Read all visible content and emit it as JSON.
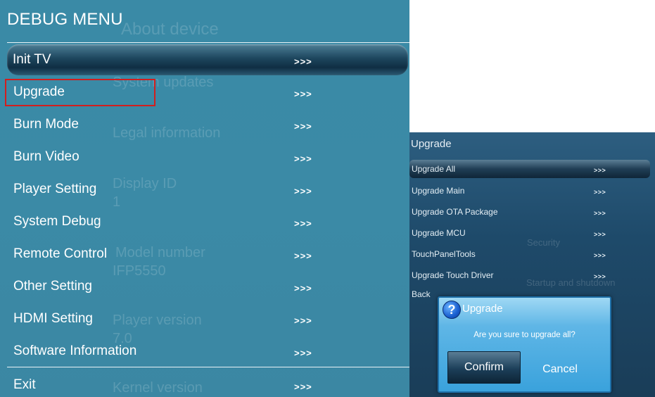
{
  "debug_menu": {
    "title": "DEBUG MENU",
    "background_texts": {
      "about": "About device",
      "updates": "System updates",
      "legal": "Legal information",
      "display_id": "Display ID",
      "display_id_value": "1",
      "model": "Model number",
      "model_value": "IFP5550",
      "player": "Player version",
      "player_value": "7.0",
      "kernel": "Kernel version"
    },
    "items": [
      {
        "label": "Init TV",
        "arrow": ">>>"
      },
      {
        "label": "Upgrade",
        "arrow": ">>>"
      },
      {
        "label": "Burn Mode",
        "arrow": ">>>"
      },
      {
        "label": "Burn Video",
        "arrow": ">>>"
      },
      {
        "label": "Player Setting",
        "arrow": ">>>"
      },
      {
        "label": "System Debug",
        "arrow": ">>>"
      },
      {
        "label": "Remote Control",
        "arrow": ">>>"
      },
      {
        "label": "Other Setting",
        "arrow": ">>>"
      },
      {
        "label": "HDMI Setting",
        "arrow": ">>>"
      },
      {
        "label": "Software Information",
        "arrow": ">>>"
      },
      {
        "label": "Exit",
        "arrow": ">>>"
      }
    ],
    "selected_item": "Init TV",
    "highlighted_item": "Upgrade"
  },
  "upgrade_panel": {
    "title": "Upgrade",
    "background_texts": {
      "security": "Security",
      "startup": "Startup and shutdown"
    },
    "items": [
      {
        "label": "Upgrade All",
        "arrow": ">>>"
      },
      {
        "label": "Upgrade Main",
        "arrow": ">>>"
      },
      {
        "label": "Upgrade OTA Package",
        "arrow": ">>>"
      },
      {
        "label": "Upgrade MCU",
        "arrow": ">>>"
      },
      {
        "label": "TouchPanelTools",
        "arrow": ">>>"
      },
      {
        "label": "Upgrade Touch Driver",
        "arrow": ">>>"
      },
      {
        "label": "Back",
        "arrow": ""
      }
    ],
    "selected_item": "Upgrade All"
  },
  "dialog": {
    "icon": "question-icon",
    "icon_glyph": "?",
    "title": "Upgrade",
    "message": "Are you sure to upgrade all?",
    "confirm_label": "Confirm",
    "cancel_label": "Cancel"
  },
  "colors": {
    "menu_bg": "#3b8aa6",
    "highlight_border": "#d21e1e",
    "dialog_bg": "#3aa2dc"
  }
}
